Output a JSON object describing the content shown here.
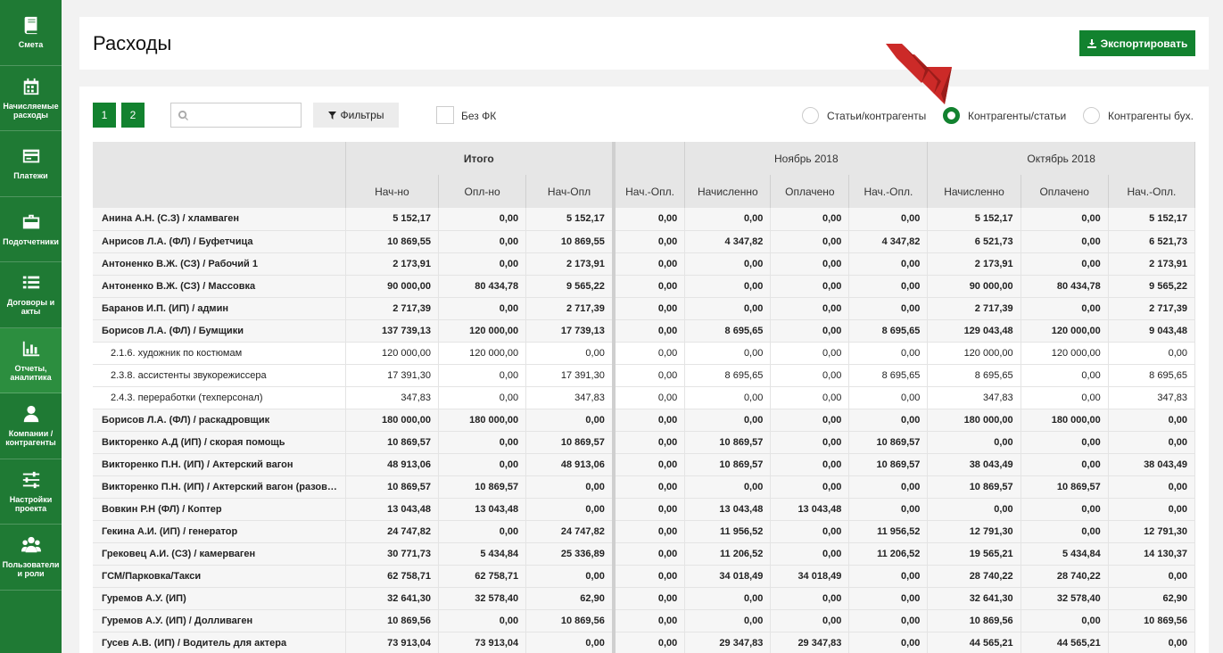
{
  "sidebar": {
    "items": [
      {
        "label": "Смета",
        "icon": "book-icon"
      },
      {
        "label": "Начисляемые расходы",
        "icon": "calendar-icon"
      },
      {
        "label": "Платежи",
        "icon": "payment-card-icon"
      },
      {
        "label": "Подотчетники",
        "icon": "briefcase-icon"
      },
      {
        "label": "Договоры и акты",
        "icon": "list-icon"
      },
      {
        "label": "Отчеты, аналитика",
        "icon": "bar-chart-icon"
      },
      {
        "label": "Компании / контрагенты",
        "icon": "user-icon"
      },
      {
        "label": "Настройки проекта",
        "icon": "sliders-icon"
      },
      {
        "label": "Пользователи и роли",
        "icon": "users-icon"
      }
    ]
  },
  "header": {
    "title": "Расходы",
    "export_label": "Экспортировать"
  },
  "toolbar": {
    "pages": [
      "1",
      "2"
    ],
    "search_value": "",
    "filter_label": "Фильтры",
    "checkbox_label": "Без ФК",
    "radios": [
      {
        "label": "Статьи/контрагенты",
        "checked": false
      },
      {
        "label": "Контрагенты/статьи",
        "checked": true
      },
      {
        "label": "Контрагенты бух.",
        "checked": false
      }
    ]
  },
  "colors": {
    "accent": "#12822f",
    "sidebar": "#1f7a34",
    "arrow": "#cc2a28"
  },
  "table": {
    "groups": [
      "Итого",
      "Ноябрь 2018",
      "Октябрь 2018"
    ],
    "columns": [
      "Нач-но",
      "Опл-но",
      "Нач-Опл",
      "Нач.-Опл.",
      "Начисленно",
      "Оплачено",
      "Нач.-Опл.",
      "Начисленно",
      "Оплачено",
      "Нач.-Опл."
    ],
    "rows": [
      {
        "name": "Анина А.Н. (С.З) / хламваген",
        "sub": false,
        "cells": [
          "5 152,17",
          "0,00",
          "5 152,17",
          "0,00",
          "0,00",
          "0,00",
          "0,00",
          "5 152,17",
          "0,00",
          "5 152,17"
        ]
      },
      {
        "name": "Анрисов Л.А. (ФЛ) / Буфетчица",
        "sub": false,
        "cells": [
          "10 869,55",
          "0,00",
          "10 869,55",
          "0,00",
          "4 347,82",
          "0,00",
          "4 347,82",
          "6 521,73",
          "0,00",
          "6 521,73"
        ]
      },
      {
        "name": "Антоненко В.Ж. (СЗ) / Рабочий 1",
        "sub": false,
        "cells": [
          "2 173,91",
          "0,00",
          "2 173,91",
          "0,00",
          "0,00",
          "0,00",
          "0,00",
          "2 173,91",
          "0,00",
          "2 173,91"
        ]
      },
      {
        "name": "Антоненко В.Ж. (СЗ) / Массовка",
        "sub": false,
        "cells": [
          "90 000,00",
          "80 434,78",
          "9 565,22",
          "0,00",
          "0,00",
          "0,00",
          "0,00",
          "90 000,00",
          "80 434,78",
          "9 565,22"
        ]
      },
      {
        "name": "Баранов И.П. (ИП) / админ",
        "sub": false,
        "cells": [
          "2 717,39",
          "0,00",
          "2 717,39",
          "0,00",
          "0,00",
          "0,00",
          "0,00",
          "2 717,39",
          "0,00",
          "2 717,39"
        ]
      },
      {
        "name": "Борисов Л.А. (ФЛ) / Бумщики",
        "sub": false,
        "cells": [
          "137 739,13",
          "120 000,00",
          "17 739,13",
          "0,00",
          "8 695,65",
          "0,00",
          "8 695,65",
          "129 043,48",
          "120 000,00",
          "9 043,48"
        ]
      },
      {
        "name": "2.1.6. художник по костюмам",
        "sub": true,
        "cells": [
          "120 000,00",
          "120 000,00",
          "0,00",
          "0,00",
          "0,00",
          "0,00",
          "0,00",
          "120 000,00",
          "120 000,00",
          "0,00"
        ]
      },
      {
        "name": "2.3.8. ассистенты звукорежиссера",
        "sub": true,
        "cells": [
          "17 391,30",
          "0,00",
          "17 391,30",
          "0,00",
          "8 695,65",
          "0,00",
          "8 695,65",
          "8 695,65",
          "0,00",
          "8 695,65"
        ]
      },
      {
        "name": "2.4.3. переработки (техперсонал)",
        "sub": true,
        "cells": [
          "347,83",
          "0,00",
          "347,83",
          "0,00",
          "0,00",
          "0,00",
          "0,00",
          "347,83",
          "0,00",
          "347,83"
        ]
      },
      {
        "name": "Борисов Л.А. (ФЛ) / раскадровщик",
        "sub": false,
        "cells": [
          "180 000,00",
          "180 000,00",
          "0,00",
          "0,00",
          "0,00",
          "0,00",
          "0,00",
          "180 000,00",
          "180 000,00",
          "0,00"
        ]
      },
      {
        "name": "Викторенко А.Д (ИП) / скорая помощь",
        "sub": false,
        "cells": [
          "10 869,57",
          "0,00",
          "10 869,57",
          "0,00",
          "10 869,57",
          "0,00",
          "10 869,57",
          "0,00",
          "0,00",
          "0,00"
        ]
      },
      {
        "name": "Викторенко П.Н. (ИП) / Актерский вагон",
        "sub": false,
        "cells": [
          "48 913,06",
          "0,00",
          "48 913,06",
          "0,00",
          "10 869,57",
          "0,00",
          "10 869,57",
          "38 043,49",
          "0,00",
          "38 043,49"
        ]
      },
      {
        "name": "Викторенко П.Н. (ИП) / Актерский вагон (разов…",
        "sub": false,
        "cells": [
          "10 869,57",
          "10 869,57",
          "0,00",
          "0,00",
          "0,00",
          "0,00",
          "0,00",
          "10 869,57",
          "10 869,57",
          "0,00"
        ]
      },
      {
        "name": "Вовкин Р.Н (ФЛ) / Коптер",
        "sub": false,
        "cells": [
          "13 043,48",
          "13 043,48",
          "0,00",
          "0,00",
          "13 043,48",
          "13 043,48",
          "0,00",
          "0,00",
          "0,00",
          "0,00"
        ]
      },
      {
        "name": "Гекина А.И. (ИП) / генератор",
        "sub": false,
        "cells": [
          "24 747,82",
          "0,00",
          "24 747,82",
          "0,00",
          "11 956,52",
          "0,00",
          "11 956,52",
          "12 791,30",
          "0,00",
          "12 791,30"
        ]
      },
      {
        "name": "Грековец А.И. (СЗ) / камерваген",
        "sub": false,
        "cells": [
          "30 771,73",
          "5 434,84",
          "25 336,89",
          "0,00",
          "11 206,52",
          "0,00",
          "11 206,52",
          "19 565,21",
          "5 434,84",
          "14 130,37"
        ]
      },
      {
        "name": "ГСМ/Парковка/Такси",
        "sub": false,
        "cells": [
          "62 758,71",
          "62 758,71",
          "0,00",
          "0,00",
          "34 018,49",
          "34 018,49",
          "0,00",
          "28 740,22",
          "28 740,22",
          "0,00"
        ]
      },
      {
        "name": "Гуремов А.У. (ИП)",
        "sub": false,
        "cells": [
          "32 641,30",
          "32 578,40",
          "62,90",
          "0,00",
          "0,00",
          "0,00",
          "0,00",
          "32 641,30",
          "32 578,40",
          "62,90"
        ]
      },
      {
        "name": "Гуремов А.У. (ИП) / Долливаген",
        "sub": false,
        "cells": [
          "10 869,56",
          "0,00",
          "10 869,56",
          "0,00",
          "0,00",
          "0,00",
          "0,00",
          "10 869,56",
          "0,00",
          "10 869,56"
        ]
      },
      {
        "name": "Гусев А.В. (ИП) / Водитель для актера",
        "sub": false,
        "cells": [
          "73 913,04",
          "73 913,04",
          "0,00",
          "0,00",
          "29 347,83",
          "29 347,83",
          "0,00",
          "44 565,21",
          "44 565,21",
          "0,00"
        ]
      }
    ]
  }
}
